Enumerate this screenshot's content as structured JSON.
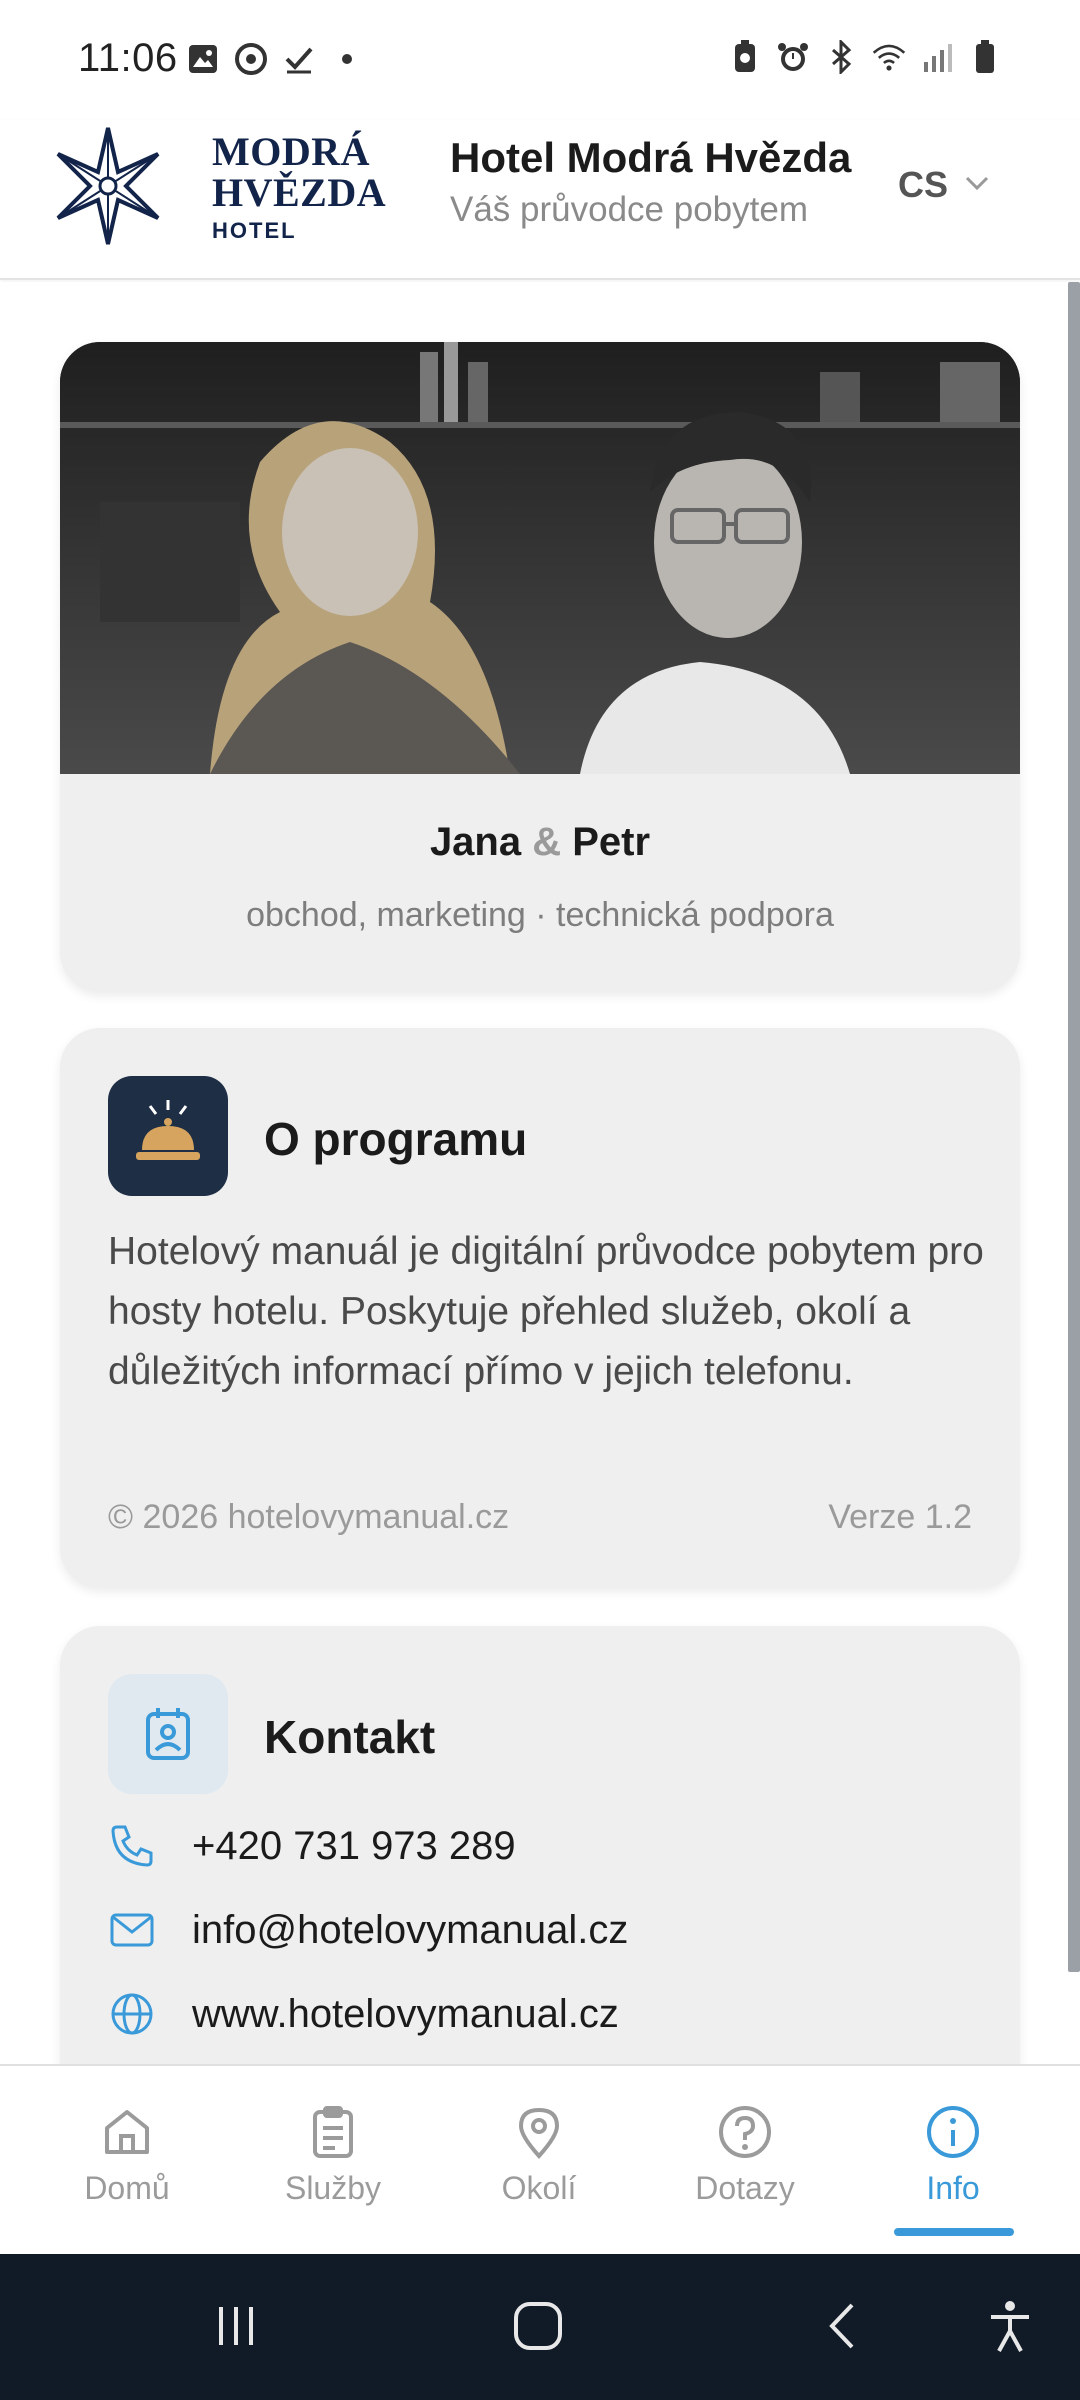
{
  "status_bar": {
    "time": "11:06",
    "left_icons": [
      "image-icon",
      "chrome-icon",
      "check-icon",
      "dot-icon"
    ],
    "right_icons": [
      "battery-saver-icon",
      "alarm-icon",
      "bluetooth-icon",
      "wifi-icon",
      "signal-icon",
      "battery-icon"
    ]
  },
  "header": {
    "logo": {
      "line1": "MODRÁ",
      "line2": "HVĚZDA",
      "line3": "HOTEL"
    },
    "title": "Hotel Modrá Hvězda",
    "subtitle": "Váš průvodce pobytem",
    "language": "CS"
  },
  "team": {
    "name1": "Jana",
    "amp": "&",
    "name2": "Petr",
    "roles": "obchod, marketing · technická podpora"
  },
  "about": {
    "title": "O programu",
    "text": "Hotelový manuál je digitální průvodce pobytem pro hosty hotelu. Poskytuje přehled služeb, okolí a důležitých informací přímo v jejich telefonu.",
    "copyright": "© 2026 hotelovymanual.cz",
    "version": "Verze 1.2"
  },
  "contact": {
    "title": "Kontakt",
    "phone": "+420 731 973 289",
    "email": "info@hotelovymanual.cz",
    "web": "www.hotelovymanual.cz"
  },
  "bottom_nav": {
    "items": [
      {
        "label": "Domů",
        "icon": "home-icon"
      },
      {
        "label": "Služby",
        "icon": "clipboard-icon"
      },
      {
        "label": "Okolí",
        "icon": "location-pin-icon"
      },
      {
        "label": "Dotazy",
        "icon": "question-icon"
      },
      {
        "label": "Info",
        "icon": "info-icon"
      }
    ],
    "active": "Info"
  },
  "colors": {
    "accent": "#3a9ad9",
    "brand_navy": "#12244a",
    "card_bg": "#efefef",
    "system_nav_bg": "#111a27"
  }
}
